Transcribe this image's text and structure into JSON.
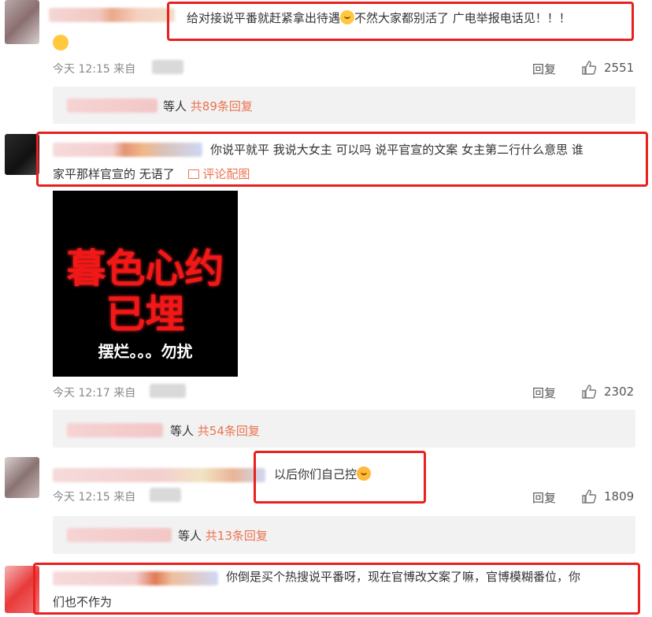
{
  "comments": [
    {
      "text_before_emoji": "给对接说平番就赶紧拿出待遇",
      "text_after_emoji": "不然大家都别活了 广电举报电话见！！！",
      "time": "今天 12:15 来自",
      "reply_label": "回复",
      "likes": "2551",
      "replies_label": "等人",
      "replies_count": "共89条回复"
    },
    {
      "text_line1": "你说平就平 我说大女主 可以吗 说平官宣的文案 女主第二行什么意思 谁",
      "text_line2": "家平那样官宣的 无语了",
      "image_link": "评论配图",
      "image_text_main1": "暮色心约",
      "image_text_main2": "已埋",
      "image_text_sub": "摆烂。。。勿扰",
      "time": "今天 12:17 来自",
      "reply_label": "回复",
      "likes": "2302",
      "replies_label": "等人",
      "replies_count": "共54条回复"
    },
    {
      "text": "以后你们自己控",
      "time": "今天 12:15 来自",
      "reply_label": "回复",
      "likes": "1809",
      "replies_label": "等人",
      "replies_count": "共13条回复"
    },
    {
      "text_line1": "你倒是买个热搜说平番呀，现在官博改文案了嘛，官博模糊番位，你",
      "text_line2": "们也不作为"
    }
  ],
  "colors": {
    "highlight": "#e8201e",
    "link": "#eb7350",
    "reply_bg": "#f2f2f2"
  }
}
